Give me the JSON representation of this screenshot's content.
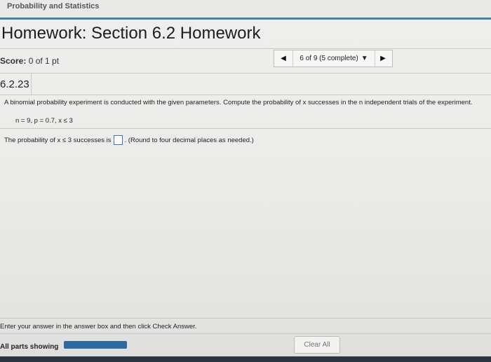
{
  "course": {
    "title": "Probability and Statistics"
  },
  "homework": {
    "title": "Homework: Section 6.2 Homework"
  },
  "score": {
    "label": "Score:",
    "value": "0 of 1 pt"
  },
  "pager": {
    "position": "6 of 9 (5 complete)",
    "prev_icon": "left-triangle",
    "next_icon": "right-triangle",
    "dropdown_icon": "down-triangle"
  },
  "question": {
    "number": "6.2.23",
    "prompt": "A binomial probability experiment is conducted with the given parameters. Compute the probability of x successes in the n independent trials of the experiment.",
    "params": "n = 9, p = 0.7, x ≤ 3",
    "answer_prefix": "The probability of x ≤ 3 successes is",
    "answer_value": "",
    "answer_suffix": ". (Round to four decimal places as needed.)"
  },
  "footer": {
    "hint": "Enter your answer in the answer box and then click Check Answer.",
    "parts_label": "All parts showing",
    "parts_progress": 1.0,
    "clear_label": "Clear All"
  },
  "colors": {
    "accent": "#4a7ea3",
    "progress": "#2c6aa0",
    "answer_border": "#3c78b0"
  }
}
